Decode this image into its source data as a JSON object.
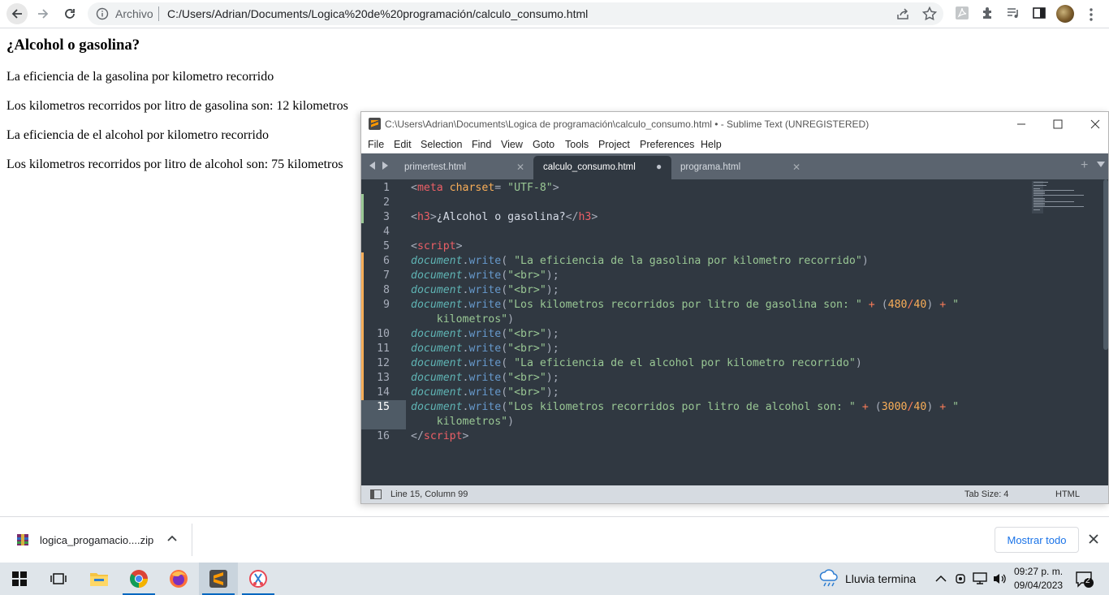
{
  "browser": {
    "scheme_label": "Archivo",
    "url": "C:/Users/Adrian/Documents/Logica%20de%20programación/calculo_consumo.html"
  },
  "page": {
    "heading": "¿Alcohol o gasolina?",
    "lines": [
      "La eficiencia de la gasolina por kilometro recorrido",
      "Los kilometros recorridos por litro de gasolina son: 12 kilometros",
      "La eficiencia de el alcohol por kilometro recorrido",
      "Los kilometros recorridos por litro de alcohol son: 75 kilometros"
    ]
  },
  "sublime": {
    "title": "C:\\Users\\Adrian\\Documents\\Logica de programación\\calculo_consumo.html • - Sublime Text (UNREGISTERED)",
    "menu": [
      "File",
      "Edit",
      "Selection",
      "Find",
      "View",
      "Goto",
      "Tools",
      "Project",
      "Preferences",
      "Help"
    ],
    "tabs": [
      {
        "label": "primertest.html",
        "active": false,
        "modified": false
      },
      {
        "label": "calculo_consumo.html",
        "active": true,
        "modified": true
      },
      {
        "label": "programa.html",
        "active": false,
        "modified": false
      }
    ],
    "line_numbers": [
      "1",
      "2",
      "3",
      "4",
      "5",
      "6",
      "7",
      "8",
      "9",
      "10",
      "11",
      "12",
      "13",
      "14",
      "15",
      "16"
    ],
    "code": {
      "l1_open": "<",
      "l1_tag": "meta",
      "l1_attr": " charset",
      "l1_eq": "= ",
      "l1_val": "\"UTF-8\"",
      "l1_close": ">",
      "l3_open": "<",
      "l3_tag": "h3",
      "l3_gt": ">",
      "l3_text": "¿Alcohol o gasolina?",
      "l3_end_open": "</",
      "l3_end_tag": "h3",
      "l3_end_gt": ">",
      "l5_open": "<",
      "l5_tag": "script",
      "l5_gt": ">",
      "obj": "document",
      "dot": ".",
      "fn": "write",
      "l6_str": "\"La eficiencia de la gasolina por kilometro recorrido\"",
      "br_str": "\"<br>\"",
      "l9_str": "\"Los kilometros recorridos por litro de gasolina son: \"",
      "l9_num1": "480",
      "l9_num2": "40",
      "kilo_str": "\" kilometros\"",
      "l12_str": "\"La eficiencia de el alcohol por kilometro recorrido\"",
      "l15_str": "\"Los kilometros recorridos por litro de alcohol son: \"",
      "l15_num1": "3000",
      "l15_num2": "40",
      "l16_open": "</",
      "l16_tag": "script",
      "l16_gt": ">",
      "paren_open": "(",
      "paren_close": ")",
      "paren_semi": ");",
      "plus": "+",
      "slash": "/",
      "kilo_open": "\"",
      "kilo_word": "kilometros\"",
      "space_paren": "( "
    },
    "status": {
      "position": "Line 15, Column 99",
      "tab_size": "Tab Size: 4",
      "syntax": "HTML"
    }
  },
  "downloads": {
    "file_name": "logica_progamacio....zip",
    "show_all": "Mostrar todo"
  },
  "taskbar": {
    "weather": "Lluvia termina",
    "time": "09:27 p. m.",
    "date": "09/04/2023",
    "notifications": "2"
  }
}
